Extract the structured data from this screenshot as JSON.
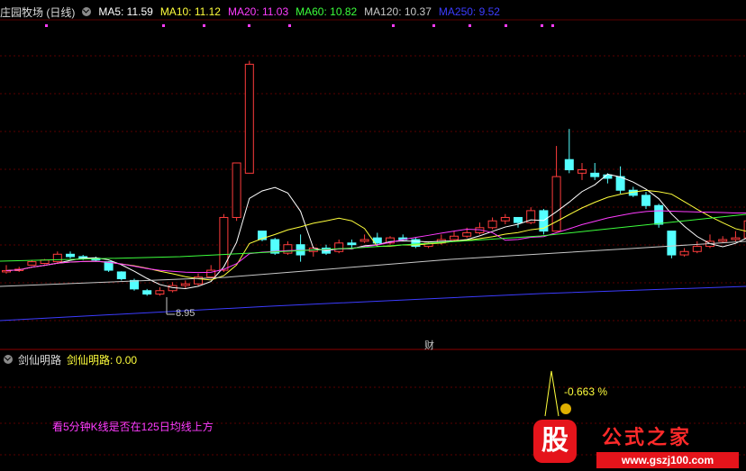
{
  "header": {
    "title": "庄园牧场 (日线)",
    "ma": [
      {
        "label": "MA5: 11.59",
        "color": "#ffffff"
      },
      {
        "label": "MA10: 11.12",
        "color": "#ffff3c"
      },
      {
        "label": "MA20: 11.03",
        "color": "#ff3cff"
      },
      {
        "label": "MA60: 10.82",
        "color": "#3cff3c"
      },
      {
        "label": "MA120: 10.37",
        "color": "#c8c8c8"
      },
      {
        "label": "MA250: 9.52",
        "color": "#3c3cff"
      }
    ]
  },
  "subpanel": {
    "title": "剑仙明路",
    "indicator": "剑仙明路: 0.00",
    "note": "看5分钟K线是否在125日均线上方",
    "percent": "-0.663 %"
  },
  "annotations": {
    "low_price": "8.95",
    "finance_marker": "财"
  },
  "watermark": {
    "text": "公式之家",
    "url": "www.gszj100.com",
    "logo_char": "股"
  },
  "colors": {
    "up": "#ff3c3c",
    "down": "#54ffff",
    "bg": "#000000",
    "grid": "#5a0000"
  },
  "chart_data": {
    "type": "candlestick",
    "candles": [
      [
        10.1,
        10.14,
        10.3,
        10.05
      ],
      [
        10.14,
        10.18,
        10.25,
        10.1
      ],
      [
        10.3,
        10.4,
        10.45,
        10.28
      ],
      [
        10.35,
        10.45,
        10.48,
        10.32
      ],
      [
        10.4,
        10.62,
        10.7,
        10.38
      ],
      [
        10.62,
        10.55,
        10.7,
        10.5
      ],
      [
        10.55,
        10.5,
        10.6,
        10.45
      ],
      [
        10.5,
        10.45,
        10.55,
        10.4
      ],
      [
        10.4,
        10.15,
        10.42,
        10.1
      ],
      [
        10.1,
        9.9,
        10.12,
        9.85
      ],
      [
        9.85,
        9.6,
        9.9,
        9.55
      ],
      [
        9.55,
        9.45,
        9.6,
        9.4
      ],
      [
        9.45,
        9.55,
        9.65,
        9.4
      ],
      [
        9.55,
        9.7,
        9.8,
        9.5
      ],
      [
        9.7,
        9.75,
        9.85,
        9.6
      ],
      [
        9.75,
        9.95,
        10.05,
        9.7
      ],
      [
        9.95,
        10.15,
        10.3,
        9.9
      ],
      [
        10.15,
        11.7,
        11.8,
        10.1
      ],
      [
        11.7,
        13.3,
        13.3,
        11.6
      ],
      [
        13.0,
        16.2,
        16.3,
        13.0
      ],
      [
        11.3,
        11.05,
        11.3,
        11.0
      ],
      [
        11.05,
        10.65,
        11.1,
        10.6
      ],
      [
        10.65,
        10.9,
        11.0,
        10.6
      ],
      [
        10.9,
        10.6,
        11.2,
        10.4
      ],
      [
        10.7,
        10.8,
        10.85,
        10.55
      ],
      [
        10.8,
        10.65,
        10.9,
        10.6
      ],
      [
        10.7,
        10.95,
        11.05,
        10.65
      ],
      [
        10.95,
        10.9,
        11.05,
        10.8
      ],
      [
        11.0,
        11.05,
        11.2,
        10.95
      ],
      [
        11.1,
        10.95,
        11.25,
        10.9
      ],
      [
        10.95,
        11.1,
        11.15,
        10.9
      ],
      [
        11.1,
        11.05,
        11.2,
        11.0
      ],
      [
        11.05,
        10.85,
        11.1,
        10.8
      ],
      [
        10.85,
        10.95,
        11.0,
        10.8
      ],
      [
        10.95,
        11.05,
        11.2,
        10.9
      ],
      [
        11.05,
        11.15,
        11.3,
        11.0
      ],
      [
        11.15,
        11.25,
        11.4,
        11.1
      ],
      [
        11.25,
        11.4,
        11.55,
        11.2
      ],
      [
        11.4,
        11.6,
        11.7,
        11.35
      ],
      [
        11.6,
        11.7,
        11.8,
        11.5
      ],
      [
        11.7,
        11.55,
        11.7,
        11.4
      ],
      [
        11.55,
        11.9,
        12.0,
        11.5
      ],
      [
        11.9,
        11.3,
        11.95,
        11.2
      ],
      [
        11.3,
        12.9,
        13.8,
        11.3
      ],
      [
        13.4,
        13.1,
        14.3,
        13.0
      ],
      [
        13.0,
        13.1,
        13.3,
        12.8
      ],
      [
        13.0,
        12.9,
        13.3,
        12.8
      ],
      [
        12.95,
        12.85,
        13.0,
        12.7
      ],
      [
        12.9,
        12.5,
        13.2,
        12.4
      ],
      [
        12.5,
        12.35,
        12.6,
        12.3
      ],
      [
        12.35,
        12.05,
        12.45,
        11.95
      ],
      [
        12.05,
        11.5,
        12.1,
        11.4
      ],
      [
        11.3,
        10.6,
        11.3,
        10.5
      ],
      [
        10.6,
        10.7,
        10.8,
        10.55
      ],
      [
        10.7,
        10.85,
        11.0,
        10.65
      ],
      [
        10.85,
        11.0,
        11.2,
        10.8
      ],
      [
        11.0,
        11.05,
        11.15,
        10.95
      ],
      [
        11.05,
        11.1,
        11.3,
        11.0
      ],
      [
        11.1,
        11.6,
        11.7,
        11.05
      ],
      [
        11.6,
        11.5,
        11.9,
        11.4
      ]
    ]
  }
}
